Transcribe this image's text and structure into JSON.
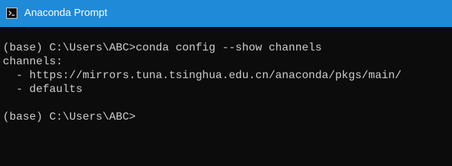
{
  "window": {
    "title": "Anaconda Prompt",
    "icon": "terminal-icon"
  },
  "console": {
    "lines": [
      "",
      "(base) C:\\Users\\ABC>conda config --show channels",
      "channels:",
      "  - https://mirrors.tuna.tsinghua.edu.cn/anaconda/pkgs/main/",
      "  - defaults",
      "",
      "(base) C:\\Users\\ABC>"
    ]
  },
  "colors": {
    "titlebar": "#1f8ad8",
    "background": "#0c0c0c",
    "text": "#cccccc"
  }
}
